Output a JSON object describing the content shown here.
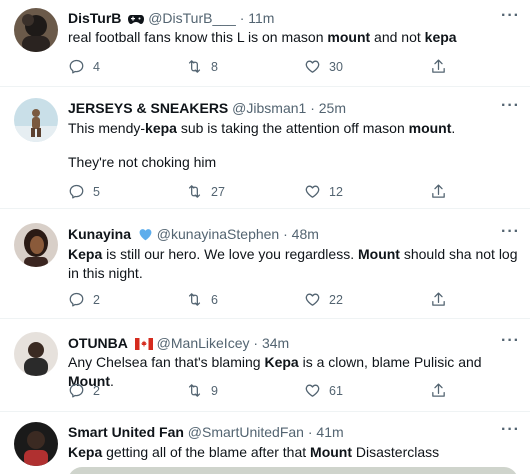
{
  "tweets": [
    {
      "name": "DisTurB",
      "name_emoji": "gamepad",
      "handle": "@DisTurB___",
      "time": "11m",
      "text_parts": [
        {
          "t": "real football fans know this L is on mason ",
          "b": false
        },
        {
          "t": "mount",
          "b": true
        },
        {
          "t": " and not ",
          "b": false
        },
        {
          "t": "kepa",
          "b": true
        }
      ],
      "extra_line": "",
      "replies": "4",
      "retweets": "8",
      "likes": "30",
      "avatar_colors": [
        "#1e1a18",
        "#6b5a4a"
      ]
    },
    {
      "name": "JERSEYS & SNEAKERS",
      "name_emoji": "",
      "handle": "@Jibsman1",
      "time": "25m",
      "text_parts": [
        {
          "t": "This mendy-",
          "b": false
        },
        {
          "t": "kepa",
          "b": true
        },
        {
          "t": " sub is taking the attention off mason ",
          "b": false
        },
        {
          "t": "mount",
          "b": true
        },
        {
          "t": ".",
          "b": false
        }
      ],
      "extra_line": "They're not choking him",
      "replies": "5",
      "retweets": "27",
      "likes": "12",
      "avatar_colors": [
        "#c9dfe8",
        "#7a5a40"
      ]
    },
    {
      "name": "Kunayina",
      "name_emoji": "blue-heart",
      "handle": "@kunayinaStephen",
      "time": "48m",
      "text_parts": [
        {
          "t": "Kepa",
          "b": true
        },
        {
          "t": " is still our hero. We love you regardless. ",
          "b": false
        },
        {
          "t": "Mount",
          "b": true
        },
        {
          "t": " should sha not log in this night.",
          "b": false
        }
      ],
      "extra_line": "",
      "replies": "2",
      "retweets": "6",
      "likes": "22",
      "avatar_colors": [
        "#2a1a14",
        "#8a5a3a"
      ]
    },
    {
      "name": "OTUNBA",
      "name_emoji": "canada-flag",
      "handle": "@ManLikeIcey",
      "time": "34m",
      "text_parts": [
        {
          "t": "Any Chelsea fan that's blaming ",
          "b": false
        },
        {
          "t": "Kepa",
          "b": true
        },
        {
          "t": " is a clown, blame Pulisic and ",
          "b": false
        },
        {
          "t": "Mount",
          "b": true
        },
        {
          "t": ".",
          "b": false
        }
      ],
      "extra_line": "",
      "replies": "2",
      "retweets": "9",
      "likes": "61",
      "avatar_colors": [
        "#e6e1dc",
        "#3a2a22"
      ]
    },
    {
      "name": "Smart United Fan",
      "name_emoji": "",
      "handle": "@SmartUnitedFan",
      "time": "41m",
      "text_parts": [
        {
          "t": "Kepa",
          "b": true
        },
        {
          "t": " getting all of the blame after that ",
          "b": false
        },
        {
          "t": "Mount",
          "b": true
        },
        {
          "t": " Disasterclass",
          "b": false
        }
      ],
      "extra_line": "",
      "replies": "",
      "retweets": "",
      "likes": "",
      "avatar_colors": [
        "#1a1a1a",
        "#b03030"
      ]
    }
  ],
  "separator": "·",
  "colors": {
    "text": "#0f1419",
    "muted": "#536471",
    "divider": "#eff3f4"
  }
}
